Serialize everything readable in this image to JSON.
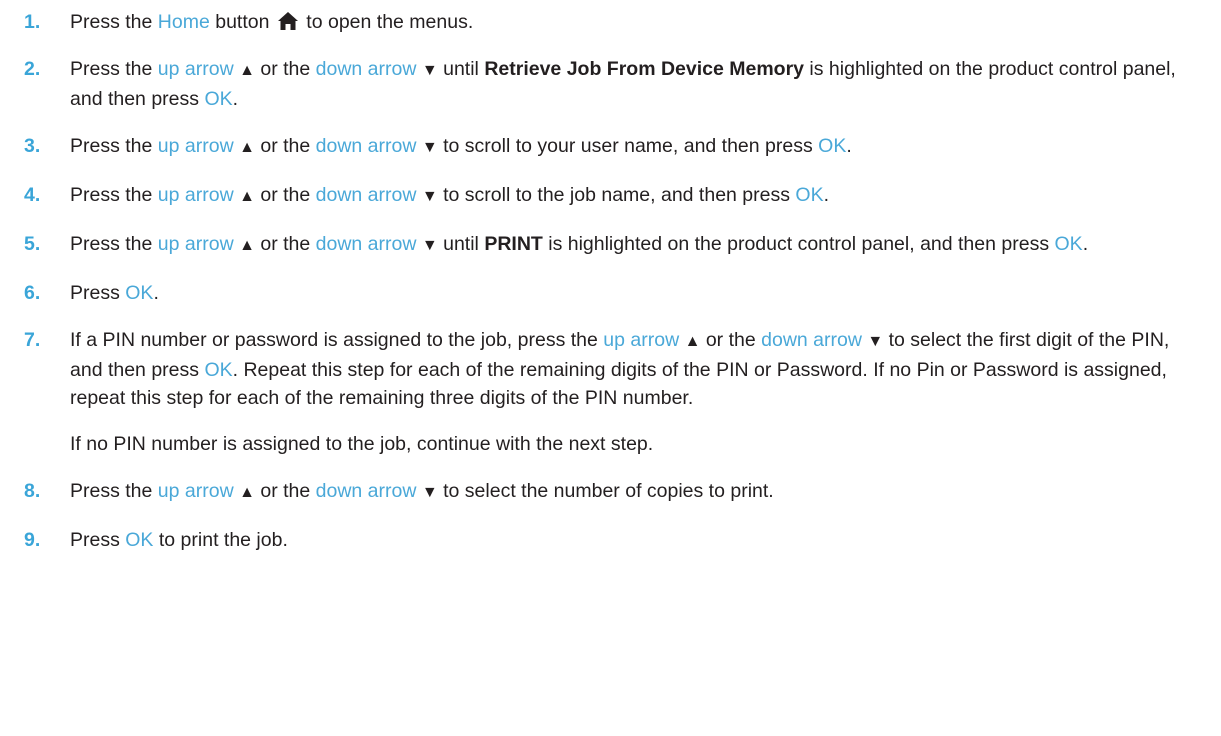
{
  "steps": [
    {
      "number": "1.",
      "t1": "Press the ",
      "k1": "Home",
      "t2": " button ",
      "icon": "home-icon",
      "t3": " to open the menus."
    },
    {
      "number": "2.",
      "t1": "Press the ",
      "k1": "up arrow",
      "a1": "▲",
      "t2": " or the ",
      "k2": "down arrow",
      "a2": "▼",
      "t3": " until ",
      "b1": "Retrieve Job From Device Memory",
      "t4": " is highlighted on the product control panel, and then press ",
      "k3": "OK",
      "t5": "."
    },
    {
      "number": "3.",
      "t1": "Press the ",
      "k1": "up arrow",
      "a1": "▲",
      "t2": " or the ",
      "k2": "down arrow",
      "a2": "▼",
      "t3": " to scroll to your user name, and then press ",
      "k3": "OK",
      "t4": "."
    },
    {
      "number": "4.",
      "t1": "Press the ",
      "k1": "up arrow",
      "a1": "▲",
      "t2": " or the ",
      "k2": "down arrow",
      "a2": "▼",
      "t3": " to scroll to the job name, and then press ",
      "k3": "OK",
      "t4": "."
    },
    {
      "number": "5.",
      "t1": "Press the ",
      "k1": "up arrow",
      "a1": "▲",
      "t2": " or the ",
      "k2": "down arrow",
      "a2": "▼",
      "t3": " until ",
      "b1": "PRINT",
      "t4": " is highlighted on the product control panel, and then press ",
      "k3": "OK",
      "t5": "."
    },
    {
      "number": "6.",
      "t1": "Press ",
      "k1": "OK",
      "t2": "."
    },
    {
      "number": "7.",
      "t1": "If a PIN number or password is assigned to the job, press the ",
      "k1": "up arrow",
      "a1": "▲",
      "t2": " or the ",
      "k2": "down arrow",
      "a2": "▼",
      "t3": " to select the first digit of the PIN, and then press ",
      "k3": "OK",
      "t4": ". Repeat this step for each of the remaining digits of the PIN or Password. If no Pin or Password is assigned, repeat this step for each of the remaining three digits of the PIN number.",
      "note": "If no PIN number is assigned to the job, continue with the next step."
    },
    {
      "number": "8.",
      "t1": "Press the ",
      "k1": "up arrow",
      "a1": "▲",
      "t2": " or the ",
      "k2": "down arrow",
      "a2": "▼",
      "t3": " to select the number of copies to print."
    },
    {
      "number": "9.",
      "t1": "Press ",
      "k1": "OK",
      "t2": " to print the job."
    }
  ],
  "colors": {
    "link": "#4aa8d8",
    "number": "#3aa5d8",
    "text": "#231f20"
  }
}
